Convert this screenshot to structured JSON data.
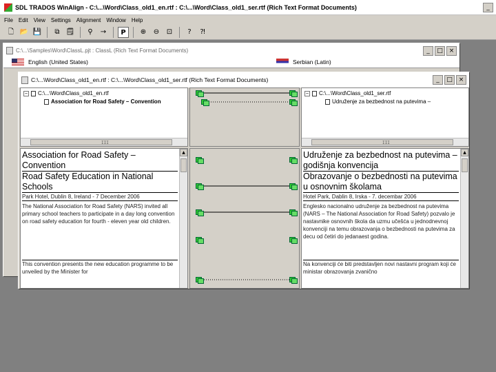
{
  "app": {
    "title": "SDL TRADOS WinAlign - C:\\...\\Word\\Class_old1_en.rtf : C:\\...\\Word\\Class_old1_ser.rtf (Rich Text Format Documents)",
    "window_buttons": {
      "minimize": "_",
      "maximize": "□",
      "close": "×"
    }
  },
  "menu": [
    "File",
    "Edit",
    "View",
    "Settings",
    "Alignment",
    "Window",
    "Help"
  ],
  "toolbar": {
    "tools": [
      {
        "name": "new-icon",
        "glyph": "🗋"
      },
      {
        "name": "open-icon",
        "glyph": "📂"
      },
      {
        "name": "save-icon",
        "glyph": "💾"
      },
      {
        "name": "copy-icon",
        "glyph": "⧉"
      },
      {
        "name": "properties-icon",
        "glyph": "🗒"
      },
      {
        "name": "binoculars-icon",
        "glyph": "⚲"
      },
      {
        "name": "arrow-right-icon",
        "glyph": "→"
      },
      {
        "name": "paragraph-icon",
        "glyph": "P"
      },
      {
        "name": "zoom-in-icon",
        "glyph": "⊕"
      },
      {
        "name": "zoom-out-icon",
        "glyph": "⊖"
      },
      {
        "name": "fit-icon",
        "glyph": "⊡"
      },
      {
        "name": "help-icon",
        "glyph": "?"
      },
      {
        "name": "context-help-icon",
        "glyph": "⁈"
      }
    ],
    "pressed": "paragraph-icon"
  },
  "project_window": {
    "title": "C:\\...\\Samples\\Word\\ClassL.pjt : ClassL (Rich Text Format Documents)",
    "source_language": "English (United States)",
    "target_language": "Serbian (Latin)"
  },
  "align_window": {
    "title": "C:\\...\\Word\\Class_old1_en.rtf : C:\\...\\Word\\Class_old1_ser.rtf (Rich Text Format Documents)",
    "tree_left": {
      "root": "C:\\...\\Word\\Class_old1_en.rtf",
      "child": "Association for Road Safety – Convention"
    },
    "tree_right": {
      "root": "C:\\...\\Word\\Class_old1_ser.rtf",
      "child": "Udruženje za bezbednost na putevima –"
    },
    "source_segments": [
      "Association for Road Safety – Convention",
      "Road Safety Education in National Schools",
      "Park Hotel, Dublin 8, Ireland - 7 December 2006",
      "The National Association for Road Safety (NARS) invited all primary school teachers to participate in a day long convention on road safety education for fourth - eleven year old children.",
      "This convention presents the new education programme to be unveiled by the Minister for"
    ],
    "target_segments": [
      "Udruženje za bezbednost na putevima – godišnja konvencija",
      "Obrazovanje o bezbednosti na putevima u osnovnim školama",
      "Hotel Park, Dablin 8, Irska - 7. decembar 2006",
      "Englesko nacionalno udruženje za bezbednost na putevima (NARS – The National Association for Road Safety) pozvalo je nastavnike osnovnih škola da uzmu učešća u jednodnevnoj konvenciji na temu obrazovanja o bezbednosti na putevima za decu od četiri do jedanaest godina.",
      "Na konvenciji će biti predstavljen novi nastavni program koji će ministar obrazovanja zvanično"
    ],
    "scroll_grip": "III"
  }
}
